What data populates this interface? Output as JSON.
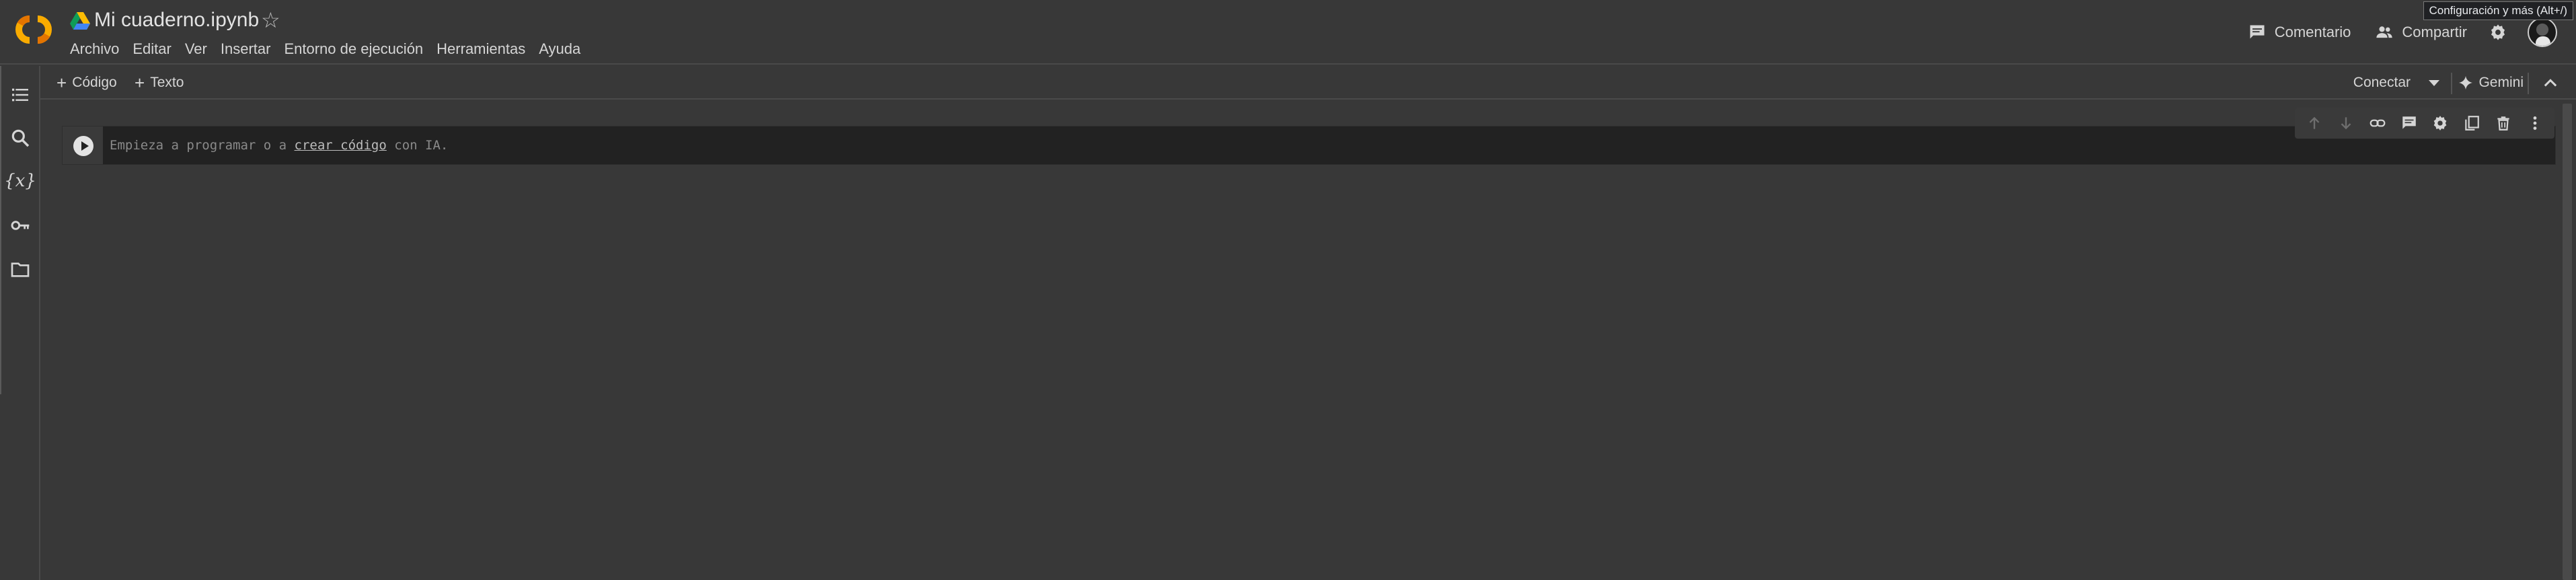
{
  "header": {
    "logo": "CO",
    "title": "Mi cuaderno.ipynb",
    "menu": [
      "Archivo",
      "Editar",
      "Ver",
      "Insertar",
      "Entorno de ejecución",
      "Herramientas",
      "Ayuda"
    ],
    "comment_label": "Comentario",
    "share_label": "Compartir",
    "tooltip": "Configuración y más (Alt+/)"
  },
  "toolbar": {
    "code_label": "Código",
    "text_label": "Texto",
    "connect_label": "Conectar",
    "gemini_label": "Gemini"
  },
  "sidebar": {
    "items": [
      "toc-icon",
      "search-icon",
      "variables-icon",
      "secrets-key-icon",
      "folder-icon"
    ],
    "variables_glyph": "{x}"
  },
  "cell": {
    "placeholder_prefix": "Empieza a programar o a ",
    "placeholder_link": "crear código",
    "placeholder_suffix": " con IA."
  },
  "colors": {
    "background": "#383838",
    "cell_background": "#222222",
    "logo_orange": "#F9AB00",
    "logo_orange_dark": "#E37400",
    "text": "#E3E3E3"
  }
}
